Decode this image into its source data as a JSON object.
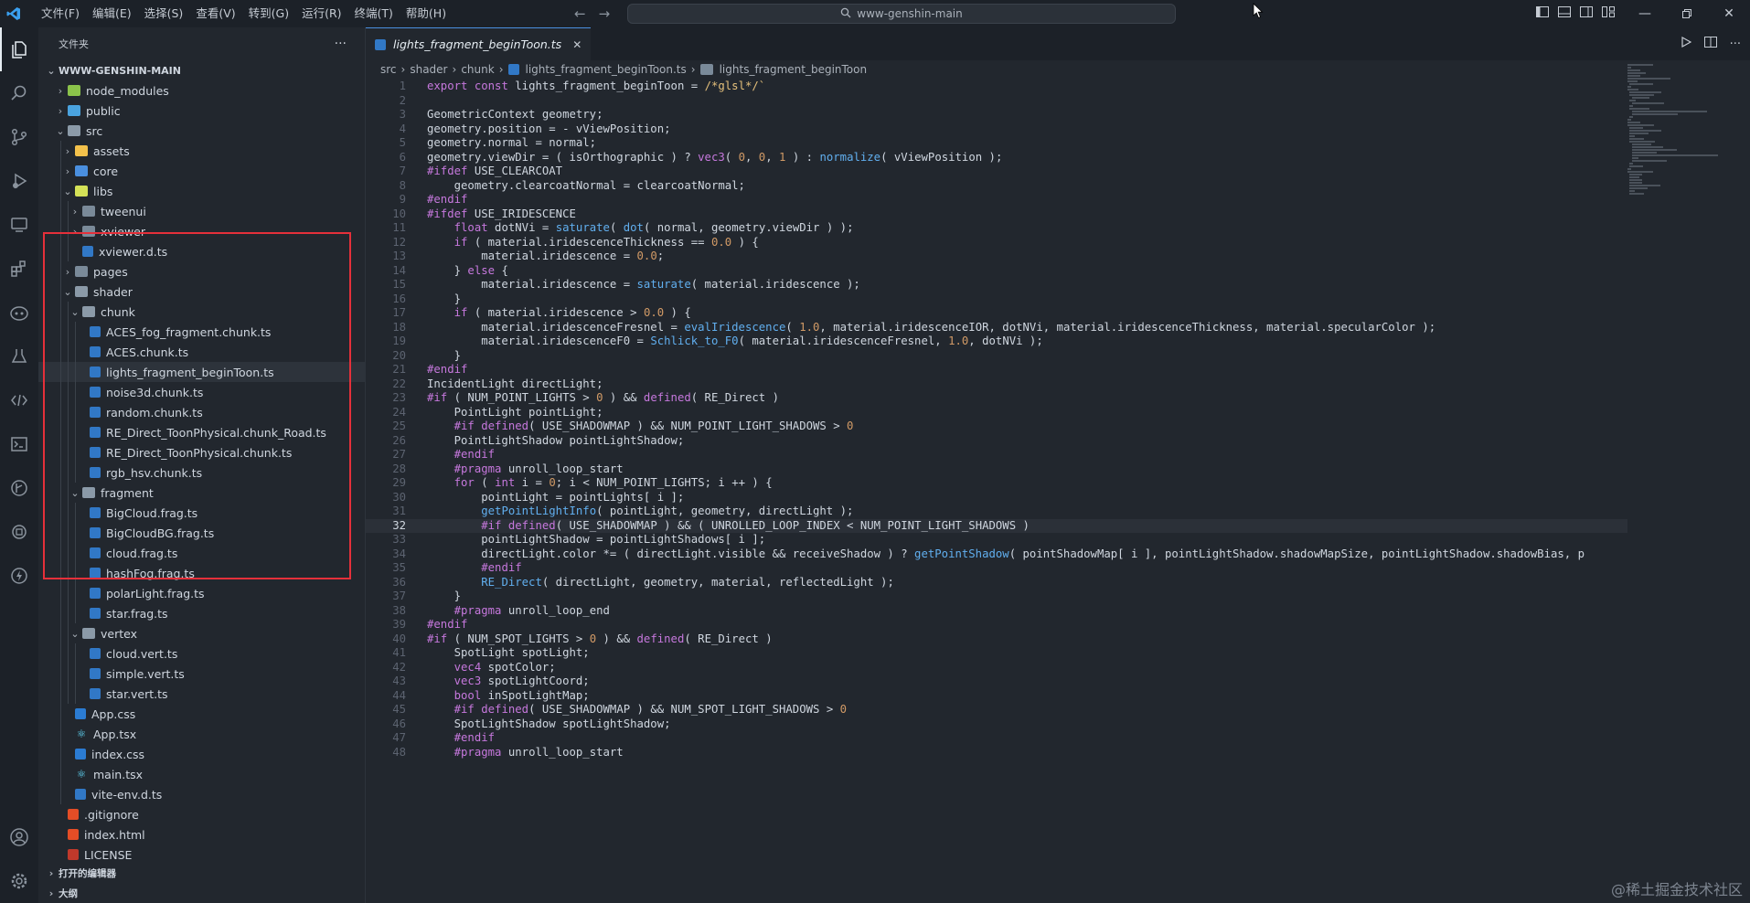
{
  "titlebar": {
    "menu": [
      "文件(F)",
      "编辑(E)",
      "选择(S)",
      "查看(V)",
      "转到(G)",
      "运行(R)",
      "终端(T)",
      "帮助(H)"
    ],
    "search_text": "www-genshin-main",
    "window_controls": [
      "minimize-icon",
      "restore-icon",
      "close-icon"
    ]
  },
  "activity_bar": {
    "icons": [
      "explorer-icon",
      "search-icon",
      "source-control-icon",
      "run-debug-icon",
      "remote-explorer-icon",
      "extensions-icon",
      "copilot-icon",
      "testing-icon",
      "api-icon",
      "terminal-icon",
      "git-graph-icon",
      "docker-icon",
      "thunder-client-icon"
    ],
    "bottom_icons": [
      "account-icon",
      "settings-icon"
    ]
  },
  "sidebar": {
    "header": "文件夹",
    "more_label": "···",
    "root": "WWW-GENSHIN-MAIN",
    "tree": [
      {
        "label": "node_modules",
        "depth": 1,
        "chev": "›",
        "icon": "node"
      },
      {
        "label": "public",
        "depth": 1,
        "chev": "›",
        "icon": "public"
      },
      {
        "label": "src",
        "depth": 1,
        "chev": "⌄",
        "icon": "folder-open"
      },
      {
        "label": "assets",
        "depth": 2,
        "chev": "›",
        "icon": "assets"
      },
      {
        "label": "core",
        "depth": 2,
        "chev": "›",
        "icon": "core"
      },
      {
        "label": "libs",
        "depth": 2,
        "chev": "⌄",
        "icon": "libs"
      },
      {
        "label": "tweenui",
        "depth": 3,
        "chev": "›",
        "icon": "folder"
      },
      {
        "label": "xviewer",
        "depth": 3,
        "chev": "›",
        "icon": "folder"
      },
      {
        "label": "xviewer.d.ts",
        "depth": 3,
        "chev": "",
        "icon": "ts"
      },
      {
        "label": "pages",
        "depth": 2,
        "chev": "›",
        "icon": "folder"
      },
      {
        "label": "shader",
        "depth": 2,
        "chev": "⌄",
        "icon": "folder-open"
      },
      {
        "label": "chunk",
        "depth": 3,
        "chev": "⌄",
        "icon": "folder-open"
      },
      {
        "label": "ACES_fog_fragment.chunk.ts",
        "depth": 4,
        "chev": "",
        "icon": "ts"
      },
      {
        "label": "ACES.chunk.ts",
        "depth": 4,
        "chev": "",
        "icon": "ts"
      },
      {
        "label": "lights_fragment_beginToon.ts",
        "depth": 4,
        "chev": "",
        "icon": "ts",
        "selected": true
      },
      {
        "label": "noise3d.chunk.ts",
        "depth": 4,
        "chev": "",
        "icon": "ts"
      },
      {
        "label": "random.chunk.ts",
        "depth": 4,
        "chev": "",
        "icon": "ts"
      },
      {
        "label": "RE_Direct_ToonPhysical.chunk_Road.ts",
        "depth": 4,
        "chev": "",
        "icon": "ts"
      },
      {
        "label": "RE_Direct_ToonPhysical.chunk.ts",
        "depth": 4,
        "chev": "",
        "icon": "ts"
      },
      {
        "label": "rgb_hsv.chunk.ts",
        "depth": 4,
        "chev": "",
        "icon": "ts"
      },
      {
        "label": "fragment",
        "depth": 3,
        "chev": "⌄",
        "icon": "folder-open"
      },
      {
        "label": "BigCloud.frag.ts",
        "depth": 4,
        "chev": "",
        "icon": "ts"
      },
      {
        "label": "BigCloudBG.frag.ts",
        "depth": 4,
        "chev": "",
        "icon": "ts"
      },
      {
        "label": "cloud.frag.ts",
        "depth": 4,
        "chev": "",
        "icon": "ts"
      },
      {
        "label": "hashFog.frag.ts",
        "depth": 4,
        "chev": "",
        "icon": "ts"
      },
      {
        "label": "polarLight.frag.ts",
        "depth": 4,
        "chev": "",
        "icon": "ts"
      },
      {
        "label": "star.frag.ts",
        "depth": 4,
        "chev": "",
        "icon": "ts"
      },
      {
        "label": "vertex",
        "depth": 3,
        "chev": "⌄",
        "icon": "folder-open"
      },
      {
        "label": "cloud.vert.ts",
        "depth": 4,
        "chev": "",
        "icon": "ts"
      },
      {
        "label": "simple.vert.ts",
        "depth": 4,
        "chev": "",
        "icon": "ts"
      },
      {
        "label": "star.vert.ts",
        "depth": 4,
        "chev": "",
        "icon": "ts"
      },
      {
        "label": "App.css",
        "depth": 2,
        "chev": "",
        "icon": "css"
      },
      {
        "label": "App.tsx",
        "depth": 2,
        "chev": "",
        "icon": "react"
      },
      {
        "label": "index.css",
        "depth": 2,
        "chev": "",
        "icon": "css"
      },
      {
        "label": "main.tsx",
        "depth": 2,
        "chev": "",
        "icon": "react"
      },
      {
        "label": "vite-env.d.ts",
        "depth": 2,
        "chev": "",
        "icon": "ts"
      },
      {
        "label": ".gitignore",
        "depth": 1,
        "chev": "",
        "icon": "git"
      },
      {
        "label": "index.html",
        "depth": 1,
        "chev": "",
        "icon": "html"
      },
      {
        "label": "LICENSE",
        "depth": 1,
        "chev": "",
        "icon": "license"
      }
    ],
    "bottom_sections": [
      "打开的编辑器",
      "大纲"
    ]
  },
  "editor": {
    "tab_label": "lights_fragment_beginToon.ts",
    "tab_close": "✕",
    "breadcrumb": [
      "src",
      "shader",
      "chunk",
      "lights_fragment_beginToon.ts",
      "lights_fragment_beginToon"
    ],
    "current_line": 32,
    "lines": [
      "export const lights_fragment_beginToon = /*glsl*/`",
      "",
      "GeometricContext geometry;",
      "geometry.position = - vViewPosition;",
      "geometry.normal = normal;",
      "geometry.viewDir = ( isOrthographic ) ? vec3( 0, 0, 1 ) : normalize( vViewPosition );",
      "#ifdef USE_CLEARCOAT",
      "    geometry.clearcoatNormal = clearcoatNormal;",
      "#endif",
      "#ifdef USE_IRIDESCENCE",
      "    float dotNVi = saturate( dot( normal, geometry.viewDir ) );",
      "    if ( material.iridescenceThickness == 0.0 ) {",
      "        material.iridescence = 0.0;",
      "    } else {",
      "        material.iridescence = saturate( material.iridescence );",
      "    }",
      "    if ( material.iridescence > 0.0 ) {",
      "        material.iridescenceFresnel = evalIridescence( 1.0, material.iridescenceIOR, dotNVi, material.iridescenceThickness, material.specularColor );",
      "        material.iridescenceF0 = Schlick_to_F0( material.iridescenceFresnel, 1.0, dotNVi );",
      "    }",
      "#endif",
      "IncidentLight directLight;",
      "#if ( NUM_POINT_LIGHTS > 0 ) && defined( RE_Direct )",
      "    PointLight pointLight;",
      "    #if defined( USE_SHADOWMAP ) && NUM_POINT_LIGHT_SHADOWS > 0",
      "    PointLightShadow pointLightShadow;",
      "    #endif",
      "    #pragma unroll_loop_start",
      "    for ( int i = 0; i < NUM_POINT_LIGHTS; i ++ ) {",
      "        pointLight = pointLights[ i ];",
      "        getPointLightInfo( pointLight, geometry, directLight );",
      "        #if defined( USE_SHADOWMAP ) && ( UNROLLED_LOOP_INDEX < NUM_POINT_LIGHT_SHADOWS )",
      "        pointLightShadow = pointLightShadows[ i ];",
      "        directLight.color *= ( directLight.visible && receiveShadow ) ? getPointShadow( pointShadowMap[ i ], pointLightShadow.shadowMapSize, pointLightShadow.shadowBias, p",
      "        #endif",
      "        RE_Direct( directLight, geometry, material, reflectedLight );",
      "    }",
      "    #pragma unroll_loop_end",
      "#endif",
      "#if ( NUM_SPOT_LIGHTS > 0 ) && defined( RE_Direct )",
      "    SpotLight spotLight;",
      "    vec4 spotColor;",
      "    vec3 spotLightCoord;",
      "    bool inSpotLightMap;",
      "    #if defined( USE_SHADOWMAP ) && NUM_SPOT_LIGHT_SHADOWS > 0",
      "    SpotLightShadow spotLightShadow;",
      "    #endif",
      "    #pragma unroll_loop_start"
    ]
  },
  "watermark": "@稀土掘金技术社区",
  "colors": {
    "keyword": "#c678dd",
    "string": "#e5c07b",
    "function": "#61afef",
    "number": "#d19a66",
    "accent": "#4a8fdf",
    "highlight_box": "#e5303a"
  }
}
